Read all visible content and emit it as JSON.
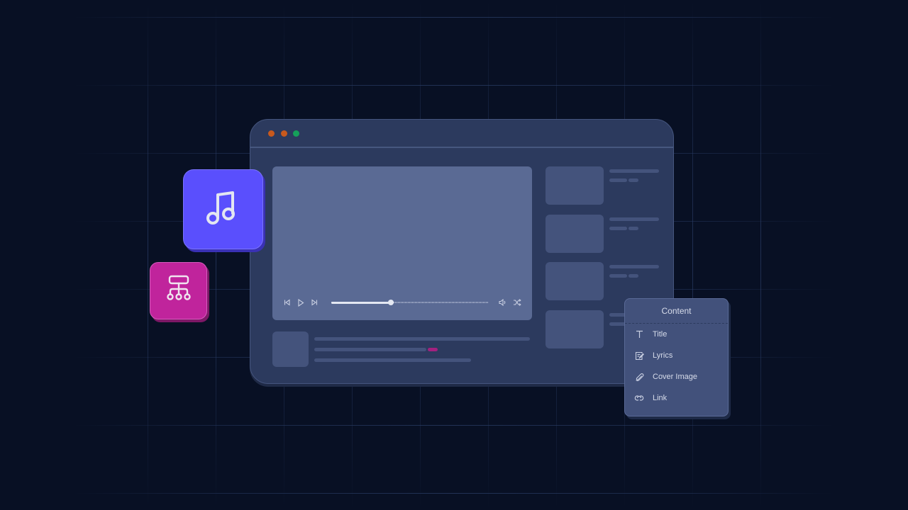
{
  "window": {
    "traffic_lights": [
      {
        "name": "close",
        "color": "#c8591d"
      },
      {
        "name": "minimize",
        "color": "#c8591d"
      },
      {
        "name": "maximize",
        "color": "#15a05a"
      }
    ]
  },
  "player": {
    "progress": 0.38,
    "controls": [
      "skip-back-icon",
      "play-icon",
      "skip-forward-icon",
      "volume-icon",
      "shuffle-icon"
    ]
  },
  "app_icons": [
    {
      "name": "music-note-icon",
      "color": "#5a4ffd"
    },
    {
      "name": "hierarchy-icon",
      "color": "#c0249c"
    }
  ],
  "accent_tag_color": "#a3217f",
  "content_menu": {
    "title": "Content",
    "items": [
      {
        "label": "Title",
        "icon": "text-icon"
      },
      {
        "label": "Lyrics",
        "icon": "edit-document-icon"
      },
      {
        "label": "Cover Image",
        "icon": "paperclip-icon"
      },
      {
        "label": "Link",
        "icon": "link-icon"
      }
    ]
  }
}
